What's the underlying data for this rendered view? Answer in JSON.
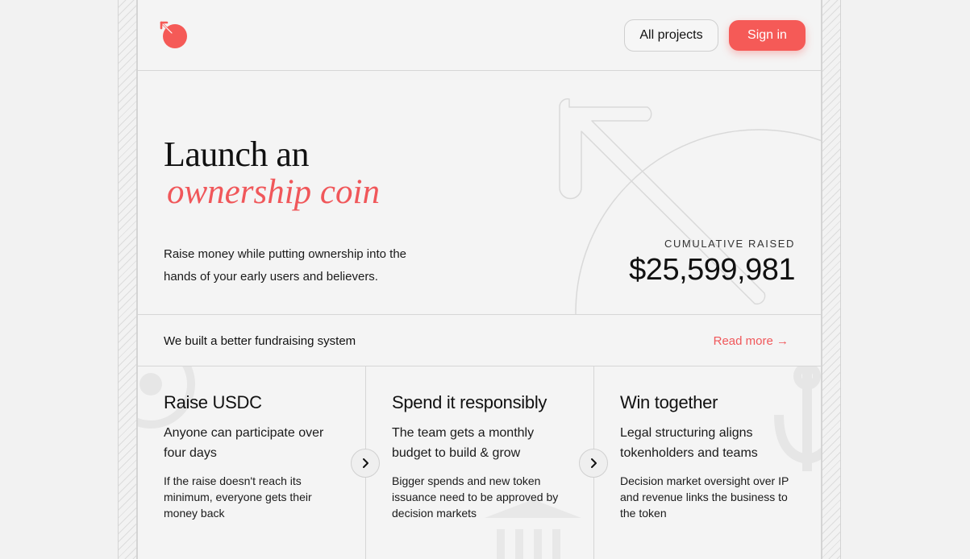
{
  "header": {
    "logo": "ownership-coin-logo",
    "all_projects_label": "All projects",
    "sign_in_label": "Sign in"
  },
  "hero": {
    "title_line1": "Launch an",
    "title_line2": "ownership coin",
    "subtitle": "Raise money while putting ownership into the hands of your early users and believers.",
    "raised_label": "CUMULATIVE RAISED",
    "raised_value": "$25,599,981"
  },
  "strip": {
    "text": "We built a better fundraising system",
    "read_more_label": "Read more →"
  },
  "features": [
    {
      "title": "Raise USDC",
      "lead": "Anyone can participate over four days",
      "body": "If the raise doesn't reach its minimum, everyone gets their money back"
    },
    {
      "title": "Spend it responsibly",
      "lead": "The team gets a monthly budget to build & grow",
      "body": "Bigger spends and new token issuance need to be approved by decision markets"
    },
    {
      "title": "Win together",
      "lead": "Legal structuring aligns tokenholders and teams",
      "body": "Decision market oversight over IP and revenue links the business to the token"
    }
  ],
  "icons": {
    "next": "chevron-right-icon"
  },
  "colors": {
    "accent": "#f55a57",
    "background": "#f4f4f4",
    "text": "#111111"
  }
}
